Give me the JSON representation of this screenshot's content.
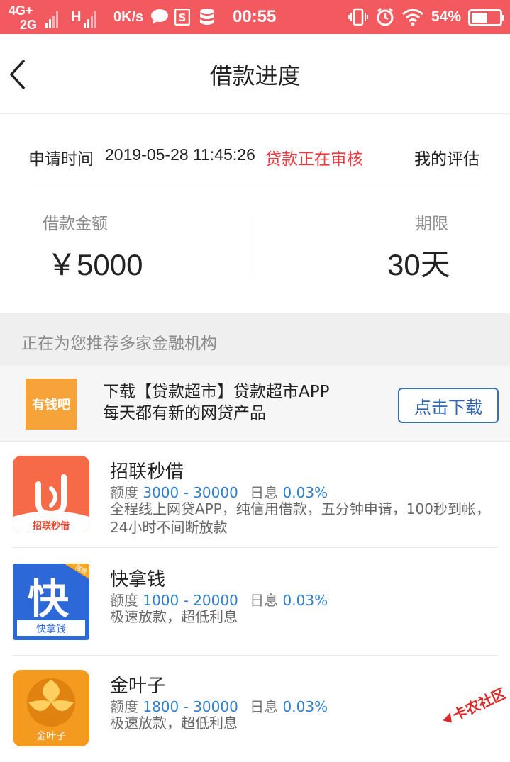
{
  "status_bar": {
    "net1": "4G+",
    "net2": "2G",
    "h": "H",
    "speed": "0K/s",
    "time": "00:55",
    "battery": "54%"
  },
  "header": {
    "title": "借款进度"
  },
  "loan": {
    "apply_label": "申请时间",
    "apply_time": "2019-05-28 11:45:26",
    "status": "贷款正在审核",
    "evaluate": "我的评估",
    "amount_label": "借款金额",
    "amount": "￥5000",
    "term_label": "期限",
    "term": "30天"
  },
  "recommend": {
    "title": "正在为您推荐多家金融机构",
    "promo": {
      "logo_text": "有钱吧",
      "line1": "下载【贷款超市】贷款超市APP",
      "line2": "每天都有新的网贷产品",
      "button": "点击下载"
    }
  },
  "products": [
    {
      "name": "招联秒借",
      "limit_label": "额度",
      "limit": "3000 - 30000",
      "rate_label": "日息",
      "rate": "0.03%",
      "desc": "全程线上网贷APP，纯信用借款，五分钟申请，100秒到帐，24小时不间断放款",
      "icon_text": "招联秒借"
    },
    {
      "name": "快拿钱",
      "limit_label": "额度",
      "limit": "1000 - 20000",
      "rate_label": "日息",
      "rate": "0.03%",
      "desc": "极速放款，超低利息",
      "icon_text": "快拿钱",
      "icon_char": "快",
      "icon_tag": "借款"
    },
    {
      "name": "金叶子",
      "limit_label": "额度",
      "limit": "1800 - 30000",
      "rate_label": "日息",
      "rate": "0.03%",
      "desc": "极速放款，超低利息",
      "icon_text": "金叶子"
    }
  ],
  "watermark": "卡农社区",
  "colors": {
    "status_bar": "#f25a5f",
    "status_red": "#f0393f",
    "link_blue": "#2e7fd2",
    "button_blue": "#2f66b3"
  }
}
